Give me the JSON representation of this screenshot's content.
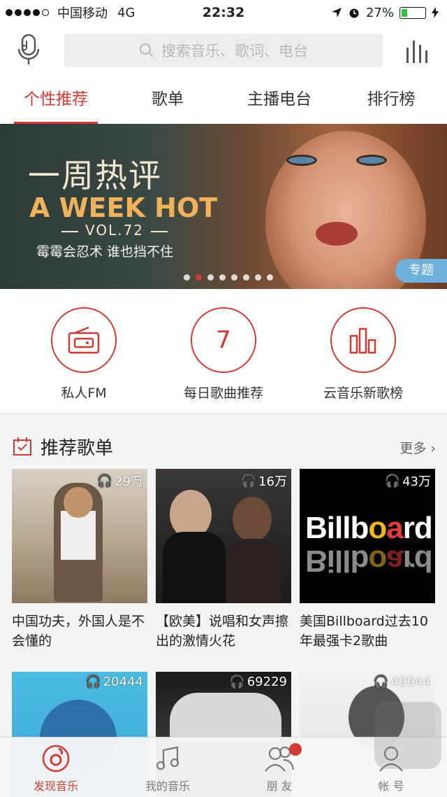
{
  "status_bar": {
    "carrier": "中国移动",
    "network": "4G",
    "time": "22:32",
    "battery": "27%",
    "battery_level": 0.27
  },
  "header": {
    "search_placeholder": "搜索音乐、歌词、电台"
  },
  "tabs": [
    {
      "label": "个性推荐",
      "active": true
    },
    {
      "label": "歌单",
      "active": false
    },
    {
      "label": "主播电台",
      "active": false
    },
    {
      "label": "排行榜",
      "active": false
    }
  ],
  "banner": {
    "title_cn": "一周热评",
    "title_en": "A WEEK HOT",
    "volume": "VOL.72",
    "subtitle": "霉霉会忍术 谁也挡不住",
    "tag": "专题",
    "dots_total": 8,
    "dots_active_index": 1
  },
  "quick_entries": [
    {
      "label": "私人FM",
      "icon": "radio-icon"
    },
    {
      "label": "每日歌曲推荐",
      "icon": "calendar-number-icon",
      "number": "7"
    },
    {
      "label": "云音乐新歌榜",
      "icon": "bar-chart-icon"
    }
  ],
  "recommended": {
    "title": "推荐歌单",
    "more": "更多",
    "playlists": [
      {
        "count": "29万",
        "title": "中国功夫，外国人是不会懂的"
      },
      {
        "count": "16万",
        "title": "【欧美】说唱和女声擦出的激情火花"
      },
      {
        "count": "43万",
        "title": "美国Billboard过去10年最强卡2歌曲",
        "cover_text": "Billboard"
      },
      {
        "count": "20444"
      },
      {
        "count": "69229"
      },
      {
        "count": "49944"
      }
    ]
  },
  "tabbar": [
    {
      "label": "发现音乐",
      "active": true,
      "icon": "music-disc-icon"
    },
    {
      "label": "我的音乐",
      "active": false,
      "icon": "music-note-icon"
    },
    {
      "label": "朋 友",
      "active": false,
      "icon": "friends-icon",
      "badge": true
    },
    {
      "label": "帐 号",
      "active": false,
      "icon": "account-icon"
    }
  ],
  "colors": {
    "accent": "#d33a31",
    "tag_blue": "#6fb0dc"
  }
}
